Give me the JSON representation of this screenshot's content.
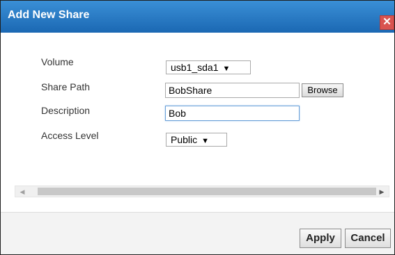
{
  "dialog": {
    "title": "Add New Share",
    "close_glyph": "✕"
  },
  "form": {
    "volume": {
      "label": "Volume",
      "value": "usb1_sda1"
    },
    "share_path": {
      "label": "Share Path",
      "value": "BobShare",
      "browse_label": "Browse"
    },
    "description": {
      "label": "Description",
      "value": "Bob"
    },
    "access_level": {
      "label": "Access Level",
      "value": "Public"
    }
  },
  "scrollbar": {
    "left_icon": "scroll-left-arrow",
    "right_icon": "scroll-right-arrow"
  },
  "buttons": {
    "apply": "Apply",
    "cancel": "Cancel"
  },
  "colors": {
    "title_bar": "#2a7cc7",
    "close": "#d9534f"
  }
}
